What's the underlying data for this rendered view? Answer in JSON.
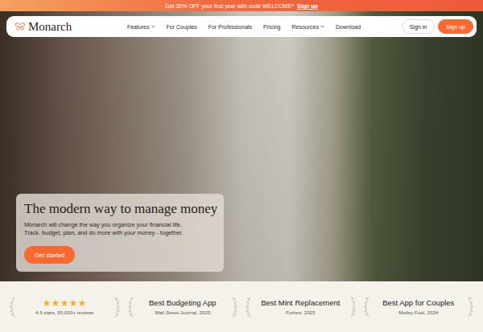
{
  "promo_bar": {
    "text": "Get 30% OFF your first year with code WELCOME*",
    "link": "Sign up"
  },
  "nav": {
    "logo": "Monarch",
    "links": [
      {
        "label": "Features",
        "dropdown": true
      },
      {
        "label": "For Couples",
        "dropdown": false
      },
      {
        "label": "For Professionals",
        "dropdown": false
      },
      {
        "label": "Pricing",
        "dropdown": false
      },
      {
        "label": "Resources",
        "dropdown": true
      },
      {
        "label": "Download",
        "dropdown": false
      }
    ],
    "sign_in": "Sign in",
    "sign_up": "Sign up"
  },
  "hero": {
    "title": "The modern way to manage money",
    "subtitle_lines": [
      "Monarch will change the way you organize your financial life.",
      "Track, budget, plan, and do more with your money - together."
    ],
    "button": "Get started"
  },
  "awards": [
    {
      "kind": "rating",
      "stars": 5,
      "caption": "4.9 stars, 50,000+ reviews"
    },
    {
      "kind": "award",
      "title": "Best Budgeting App",
      "source": "Wall Street Journal, 2025"
    },
    {
      "kind": "award",
      "title": "Best Mint Replacement",
      "source": "Forbes, 2025"
    },
    {
      "kind": "award",
      "title": "Best App for Couples",
      "source": "Motley Fool, 2024"
    }
  ]
}
